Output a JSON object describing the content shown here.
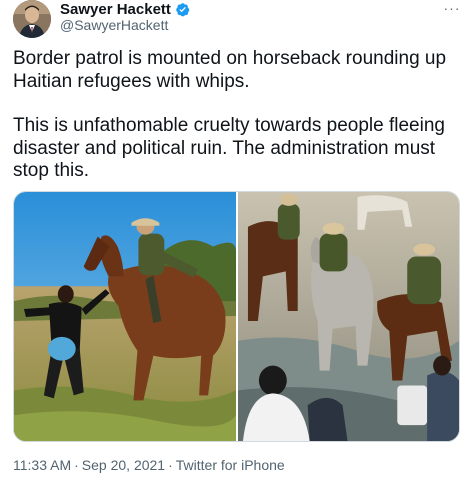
{
  "author": {
    "display_name": "Sawyer Hackett",
    "handle": "@SawyerHackett",
    "avatar_icon": "profile-avatar",
    "verified_icon": "verified-badge-icon",
    "verified_color": "#1d9bf0"
  },
  "more_label": "···",
  "tweet": {
    "paragraphs": [
      "Border patrol is mounted on horseback rounding up Haitian refugees with whips.",
      "This is unfathomable cruelty towards people fleeing disaster and political ruin. The administration must stop this."
    ]
  },
  "media": {
    "photo_count": 2
  },
  "meta": {
    "time": "11:33 AM",
    "date": "Sep 20, 2021",
    "source": "Twitter for iPhone",
    "separator": "·"
  }
}
